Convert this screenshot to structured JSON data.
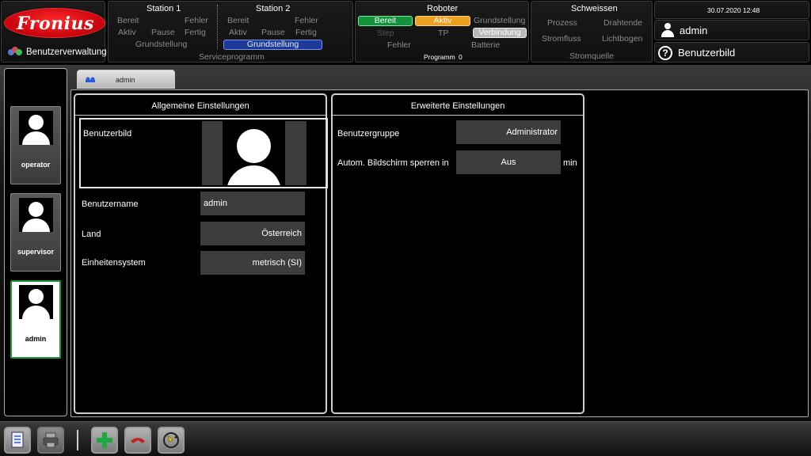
{
  "header": {
    "logo_text": "Fronius",
    "app_name": "Benutzerverwaltung",
    "station1": {
      "title": "Station 1",
      "bereit": "Bereit",
      "fehler": "Fehler",
      "aktiv": "Aktiv",
      "pause": "Pause",
      "fertig": "Fertig",
      "grundstellung": "Grundstellung"
    },
    "station2": {
      "title": "Station 2",
      "bereit": "Bereit",
      "fehler": "Fehler",
      "aktiv": "Aktiv",
      "pause": "Pause",
      "fertig": "Fertig",
      "grundstellung": "Grundstellung"
    },
    "serviceprogramm": "Serviceprogramm",
    "roboter": {
      "title": "Roboter",
      "bereit": "Bereit",
      "aktiv": "Aktiv",
      "grundstellung": "Grundstellung",
      "step": "Step",
      "tp": "TP",
      "verbindung": "Verbindung",
      "fehler": "Fehler",
      "batterie": "Batterie",
      "programm_label": "Programm",
      "programm_value": "0"
    },
    "schweissen": {
      "title": "Schweissen",
      "prozess": "Prozess",
      "drahtende": "Drahtende",
      "stromfluss": "Stromfluss",
      "lichtbogen": "Lichtbogen",
      "stromquelle": "Stromquelle"
    },
    "datetime": "30.07.2020 12:48",
    "current_user": "admin",
    "benutzerbild_button": "Benutzerbild"
  },
  "sidebar": {
    "users": [
      {
        "name": "operator",
        "active": false
      },
      {
        "name": "supervisor",
        "active": false
      },
      {
        "name": "admin",
        "active": true
      }
    ]
  },
  "tab": {
    "label": "admin"
  },
  "general": {
    "title": "Allgemeine Einstellungen",
    "benutzerbild_label": "Benutzerbild",
    "benutzername_label": "Benutzername",
    "benutzername_value": "admin",
    "land_label": "Land",
    "land_value": "Österreich",
    "einheitensystem_label": "Einheitensystem",
    "einheitensystem_value": "metrisch (SI)"
  },
  "advanced": {
    "title": "Erweiterte Einstellungen",
    "benutzergruppe_label": "Benutzergruppe",
    "benutzergruppe_value": "Administrator",
    "sperren_label": "Autom. Bildschirm sperren in",
    "sperren_value": "Aus",
    "sperren_unit": "min"
  },
  "toolbar": {
    "buttons": [
      "document-icon",
      "printer-icon",
      "add-icon",
      "delete-icon",
      "refresh-icon"
    ]
  },
  "colors": {
    "green": "#13933a",
    "orange": "#f0a020",
    "blue": "#1d3a99",
    "brand_red": "#c8000b"
  }
}
